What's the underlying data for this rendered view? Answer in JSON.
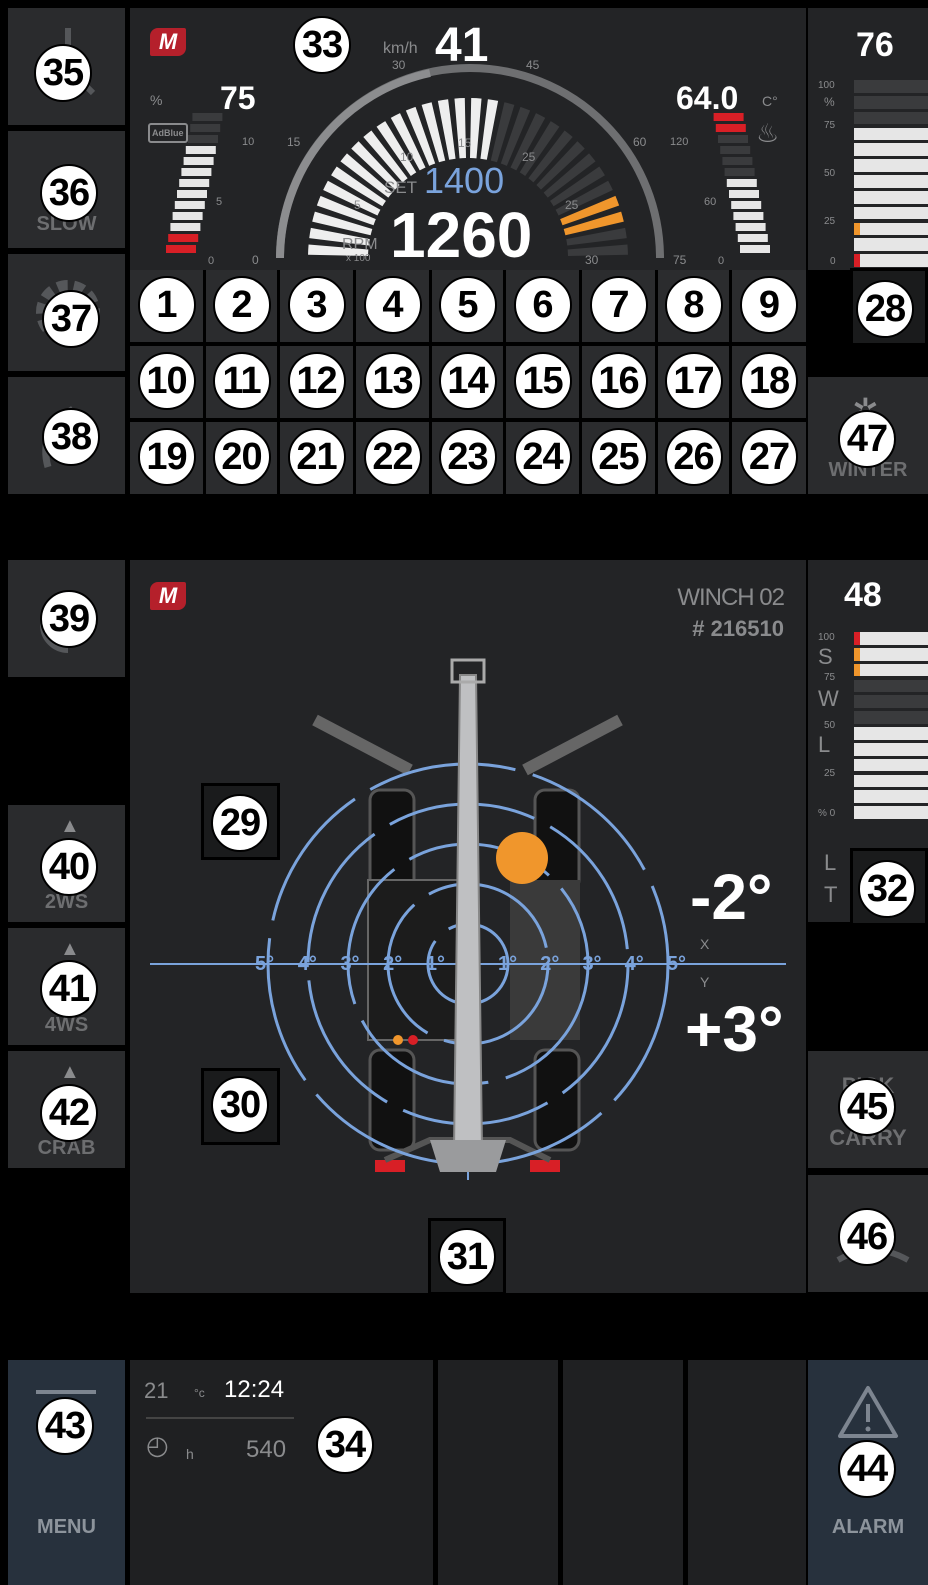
{
  "colors": {
    "accent_blue": "#7aa3dc",
    "warn_orange": "#f0962c",
    "alert_red": "#d81f26",
    "panel": "#232426",
    "button": "#2a2b2d",
    "menu_blue": "#27313d"
  },
  "dash": {
    "speed_unit": "km/h",
    "speed": "41",
    "speed_ticks": [
      "30",
      "45",
      "15",
      "60"
    ],
    "adblue_percent": "75",
    "adblue_unit": "%",
    "adblue_label": "AdBlue",
    "adblue_ticks": [
      "10",
      "5",
      "0"
    ],
    "coolant_temp": "64.0",
    "coolant_unit": "C°",
    "coolant_ticks": [
      "120",
      "60",
      "0"
    ],
    "rpm_set_label": "SET",
    "rpm_set": "1400",
    "rpm": "1260",
    "rpm_label": "RPM",
    "rpm_mult": "x 100",
    "rpm_ticks": [
      "10",
      "15",
      "25",
      "5",
      "25",
      "30",
      "0",
      "75"
    ]
  },
  "right_top": {
    "value": "76",
    "ticks": [
      "100",
      "%",
      "75",
      "50",
      "25",
      "0"
    ]
  },
  "right_mid": {
    "value": "48",
    "ticks": [
      "100",
      "75",
      "50",
      "25",
      "% 0"
    ],
    "letters": [
      "S",
      "W",
      "L"
    ],
    "lt": [
      "L",
      "T"
    ]
  },
  "buttons": {
    "slow_label": "SLOW",
    "winter_label": "WINTER",
    "ws2_label": "2WS",
    "ws4_label": "4WS",
    "crab_label": "CRAB",
    "pick_label": "PICK",
    "carry_label": "CARRY",
    "menu_label": "MENU",
    "alarm_label": "ALARM"
  },
  "winch": {
    "name": "WINCH 02",
    "serial": "# 216510"
  },
  "level": {
    "x_angle": "-2°",
    "y_angle": "+3°",
    "x_label": "X",
    "y_label": "Y",
    "scale_left": [
      "5°",
      "4°",
      "3°",
      "2°",
      "1°"
    ],
    "scale_right": [
      "1°",
      "2°",
      "3°",
      "4°",
      "5°"
    ]
  },
  "status": {
    "temp": "21",
    "temp_unit": "°c",
    "time": "12:24",
    "hours_unit": "h",
    "hours": "540"
  },
  "badges": {
    "grid": [
      "1",
      "2",
      "3",
      "4",
      "5",
      "6",
      "7",
      "8",
      "9",
      "10",
      "11",
      "12",
      "13",
      "14",
      "15",
      "16",
      "17",
      "18",
      "19",
      "20",
      "21",
      "22",
      "23",
      "24",
      "25",
      "26",
      "27"
    ],
    "b28": "28",
    "b29": "29",
    "b30": "30",
    "b31": "31",
    "b32": "32",
    "b33": "33",
    "b34": "34",
    "b35": "35",
    "b36": "36",
    "b37": "37",
    "b38": "38",
    "b39": "39",
    "b40": "40",
    "b41": "41",
    "b42": "42",
    "b43": "43",
    "b44": "44",
    "b45": "45",
    "b46": "46",
    "b47": "47"
  }
}
